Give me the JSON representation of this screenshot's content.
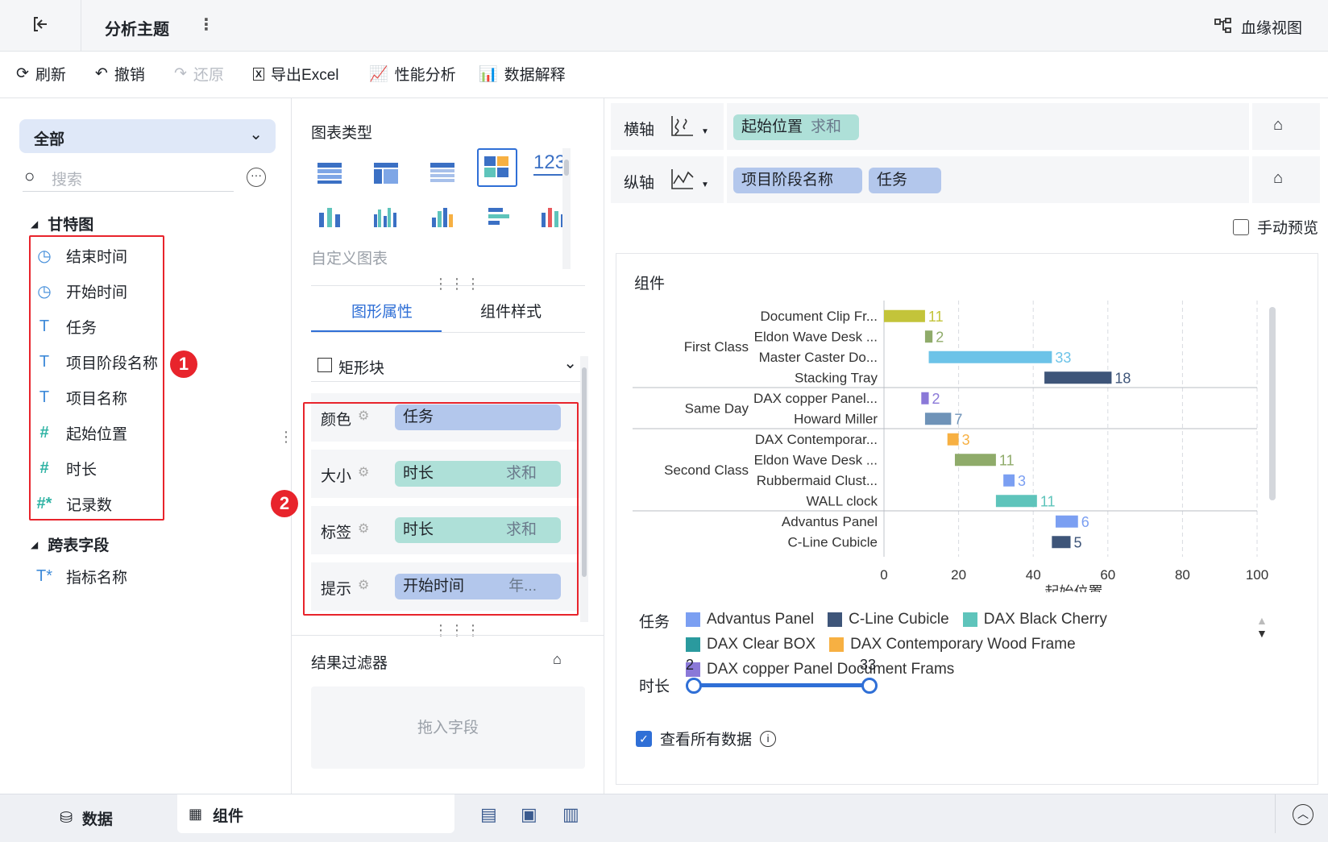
{
  "topbar": {
    "title": "分析主题",
    "lineage_label": "血缘视图"
  },
  "toolbar": {
    "refresh": "刷新",
    "undo": "撤销",
    "redo": "还原",
    "export_excel": "导出Excel",
    "perf": "性能分析",
    "explain": "数据解释"
  },
  "left": {
    "scope": "全部",
    "search_placeholder": "搜索",
    "group1": "甘特图",
    "fields": [
      {
        "label": "结束时间",
        "icon": "clock-icon"
      },
      {
        "label": "开始时间",
        "icon": "clock-icon"
      },
      {
        "label": "任务",
        "icon": "text-field-icon"
      },
      {
        "label": "项目阶段名称",
        "icon": "text-field-icon"
      },
      {
        "label": "项目名称",
        "icon": "text-field-icon"
      },
      {
        "label": "起始位置",
        "icon": "number-field-icon"
      },
      {
        "label": "时长",
        "icon": "number-field-icon"
      },
      {
        "label": "记录数",
        "icon": "count-field-icon"
      }
    ],
    "group2": "跨表字段",
    "cross_field": "指标名称",
    "badge1": "1"
  },
  "middle": {
    "chart_type_title": "图表类型",
    "number_icon_text": "123",
    "custom_chart": "自定义图表",
    "tab_active": "图形属性",
    "tab_other": "组件样式",
    "mark_type": "矩形块",
    "props": [
      {
        "label": "颜色",
        "field": "任务",
        "agg": "",
        "color": "blue"
      },
      {
        "label": "大小",
        "field": "时长",
        "agg": "求和",
        "color": "green"
      },
      {
        "label": "标签",
        "field": "时长",
        "agg": "求和",
        "color": "green"
      },
      {
        "label": "提示",
        "field": "开始时间",
        "agg": "年...",
        "color": "blue"
      }
    ],
    "badge2": "2",
    "filter_title": "结果过滤器",
    "filter_drop": "拖入字段"
  },
  "right": {
    "x_axis_label": "横轴",
    "x_field": "起始位置",
    "x_agg": "求和",
    "y_axis_label": "纵轴",
    "y_fields": [
      "项目阶段名称",
      "任务"
    ],
    "manual_preview": "手动预览",
    "component_title": "组件",
    "legend_task_label": "任务",
    "legend_items": [
      {
        "name": "Advantus Panel",
        "color": "#7b9ff2"
      },
      {
        "name": "C-Line Cubicle",
        "color": "#3e5579"
      },
      {
        "name": "DAX Black Cherry",
        "color": "#5ec4bb"
      },
      {
        "name": "DAX Clear BOX",
        "color": "#2a9a9e"
      },
      {
        "name": "DAX Contemporary Wood Frame",
        "color": "#f7b042"
      },
      {
        "name": "DAX copper Panel Document Frams",
        "color": "#8a78d8"
      }
    ],
    "legend_size_label": "时长",
    "size_min": "2",
    "size_max": "33",
    "view_all": "查看所有数据"
  },
  "chart_data": {
    "type": "bar",
    "subtype": "gantt",
    "xlabel": "起始位置",
    "xlim": [
      0,
      100
    ],
    "xticks": [
      0,
      20,
      40,
      60,
      80,
      100
    ],
    "groups": [
      {
        "name": "First Class",
        "tasks": [
          {
            "label": "Document Clip Fr...",
            "start": 0,
            "value": 11,
            "color": "#c3c43a"
          },
          {
            "label": "Eldon Wave Desk ...",
            "start": 11,
            "value": 2,
            "color": "#8fab6a"
          },
          {
            "label": "Master Caster Do...",
            "start": 12,
            "value": 33,
            "color": "#6cc3e8"
          },
          {
            "label": "Stacking Tray",
            "start": 43,
            "value": 18,
            "color": "#3e5579"
          }
        ]
      },
      {
        "name": "Same Day",
        "tasks": [
          {
            "label": "DAX copper Panel...",
            "start": 10,
            "value": 2,
            "color": "#8a78d8"
          },
          {
            "label": "Howard Miller",
            "start": 11,
            "value": 7,
            "color": "#6f93b8"
          }
        ]
      },
      {
        "name": "Second Class",
        "tasks": [
          {
            "label": "DAX Contemporar...",
            "start": 17,
            "value": 3,
            "color": "#f7b042"
          },
          {
            "label": "Eldon Wave Desk ...",
            "start": 19,
            "value": 11,
            "color": "#8fab6a"
          },
          {
            "label": "Rubbermaid Clust...",
            "start": 32,
            "value": 3,
            "color": "#7b9ff2"
          },
          {
            "label": "WALL clock",
            "start": 30,
            "value": 11,
            "color": "#5ec4bb"
          }
        ]
      },
      {
        "name": "",
        "tasks": [
          {
            "label": "Advantus Panel",
            "start": 46,
            "value": 6,
            "color": "#7b9ff2"
          },
          {
            "label": "C-Line Cubicle",
            "start": 45,
            "value": 5,
            "color": "#3e5579"
          }
        ]
      }
    ]
  },
  "bottom": {
    "tab_data": "数据",
    "tab_component": "组件"
  }
}
